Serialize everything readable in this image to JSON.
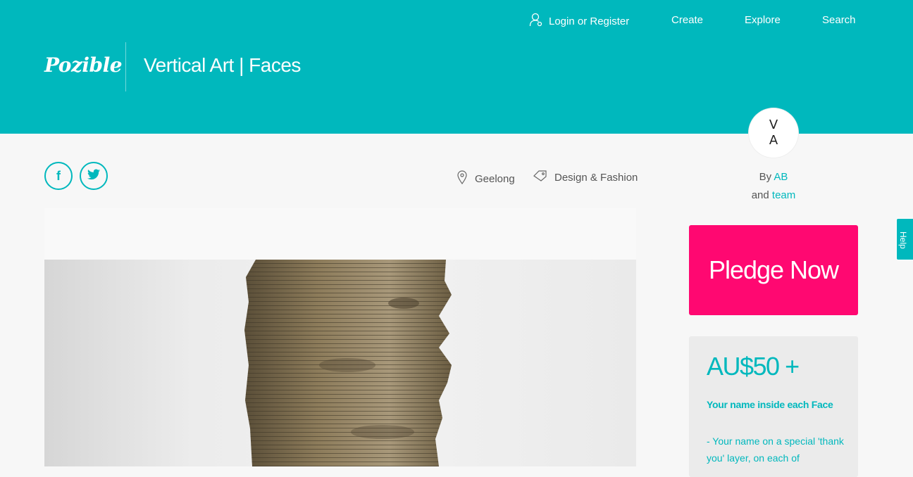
{
  "header": {
    "logo": "Pozible",
    "project_title": "Vertical Art | Faces",
    "nav": {
      "login": "Login or Register",
      "create": "Create",
      "explore": "Explore",
      "search": "Search"
    }
  },
  "avatar": {
    "top": "V",
    "bottom": "A"
  },
  "social": {
    "facebook": "f"
  },
  "meta": {
    "location": "Geelong",
    "category": "Design & Fashion"
  },
  "byline": {
    "by": "By",
    "creator": "AB",
    "and": "and",
    "team": "team"
  },
  "pledge": {
    "label": "Pledge Now"
  },
  "reward": {
    "amount": "AU$50 +",
    "title": "Your name inside each Face",
    "description": "- Your name on a special 'thank you' layer, on each of"
  },
  "help": {
    "label": "Help"
  },
  "colors": {
    "brand": "#00b8bd",
    "pledge": "#ff0871"
  }
}
